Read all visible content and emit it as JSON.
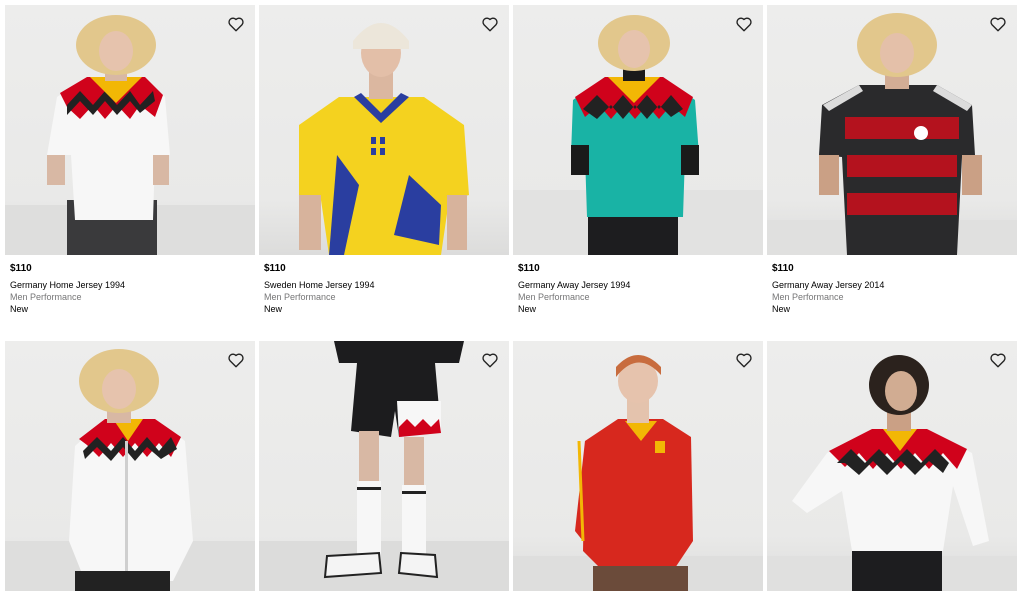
{
  "products": [
    {
      "price": "$110",
      "name": "Germany Home Jersey 1994",
      "category": "Men Performance",
      "badge": "New"
    },
    {
      "price": "$110",
      "name": "Sweden Home Jersey 1994",
      "category": "Men Performance",
      "badge": "New"
    },
    {
      "price": "$110",
      "name": "Germany Away Jersey 1994",
      "category": "Men Performance",
      "badge": "New"
    },
    {
      "price": "$110",
      "name": "Germany Away Jersey 2014",
      "category": "Men Performance",
      "badge": "New"
    }
  ],
  "icons": {
    "wishlist": "heart-outline-icon"
  },
  "colors": {
    "text": "#000000",
    "muted": "#767677",
    "tile_bg": "#ededec",
    "germany_red": "#d0021b",
    "germany_gold": "#f2b705",
    "sweden_yellow": "#f4d21f",
    "sweden_blue": "#2a3ea0",
    "teal": "#19b3a5",
    "belgium_red": "#d7281e"
  }
}
